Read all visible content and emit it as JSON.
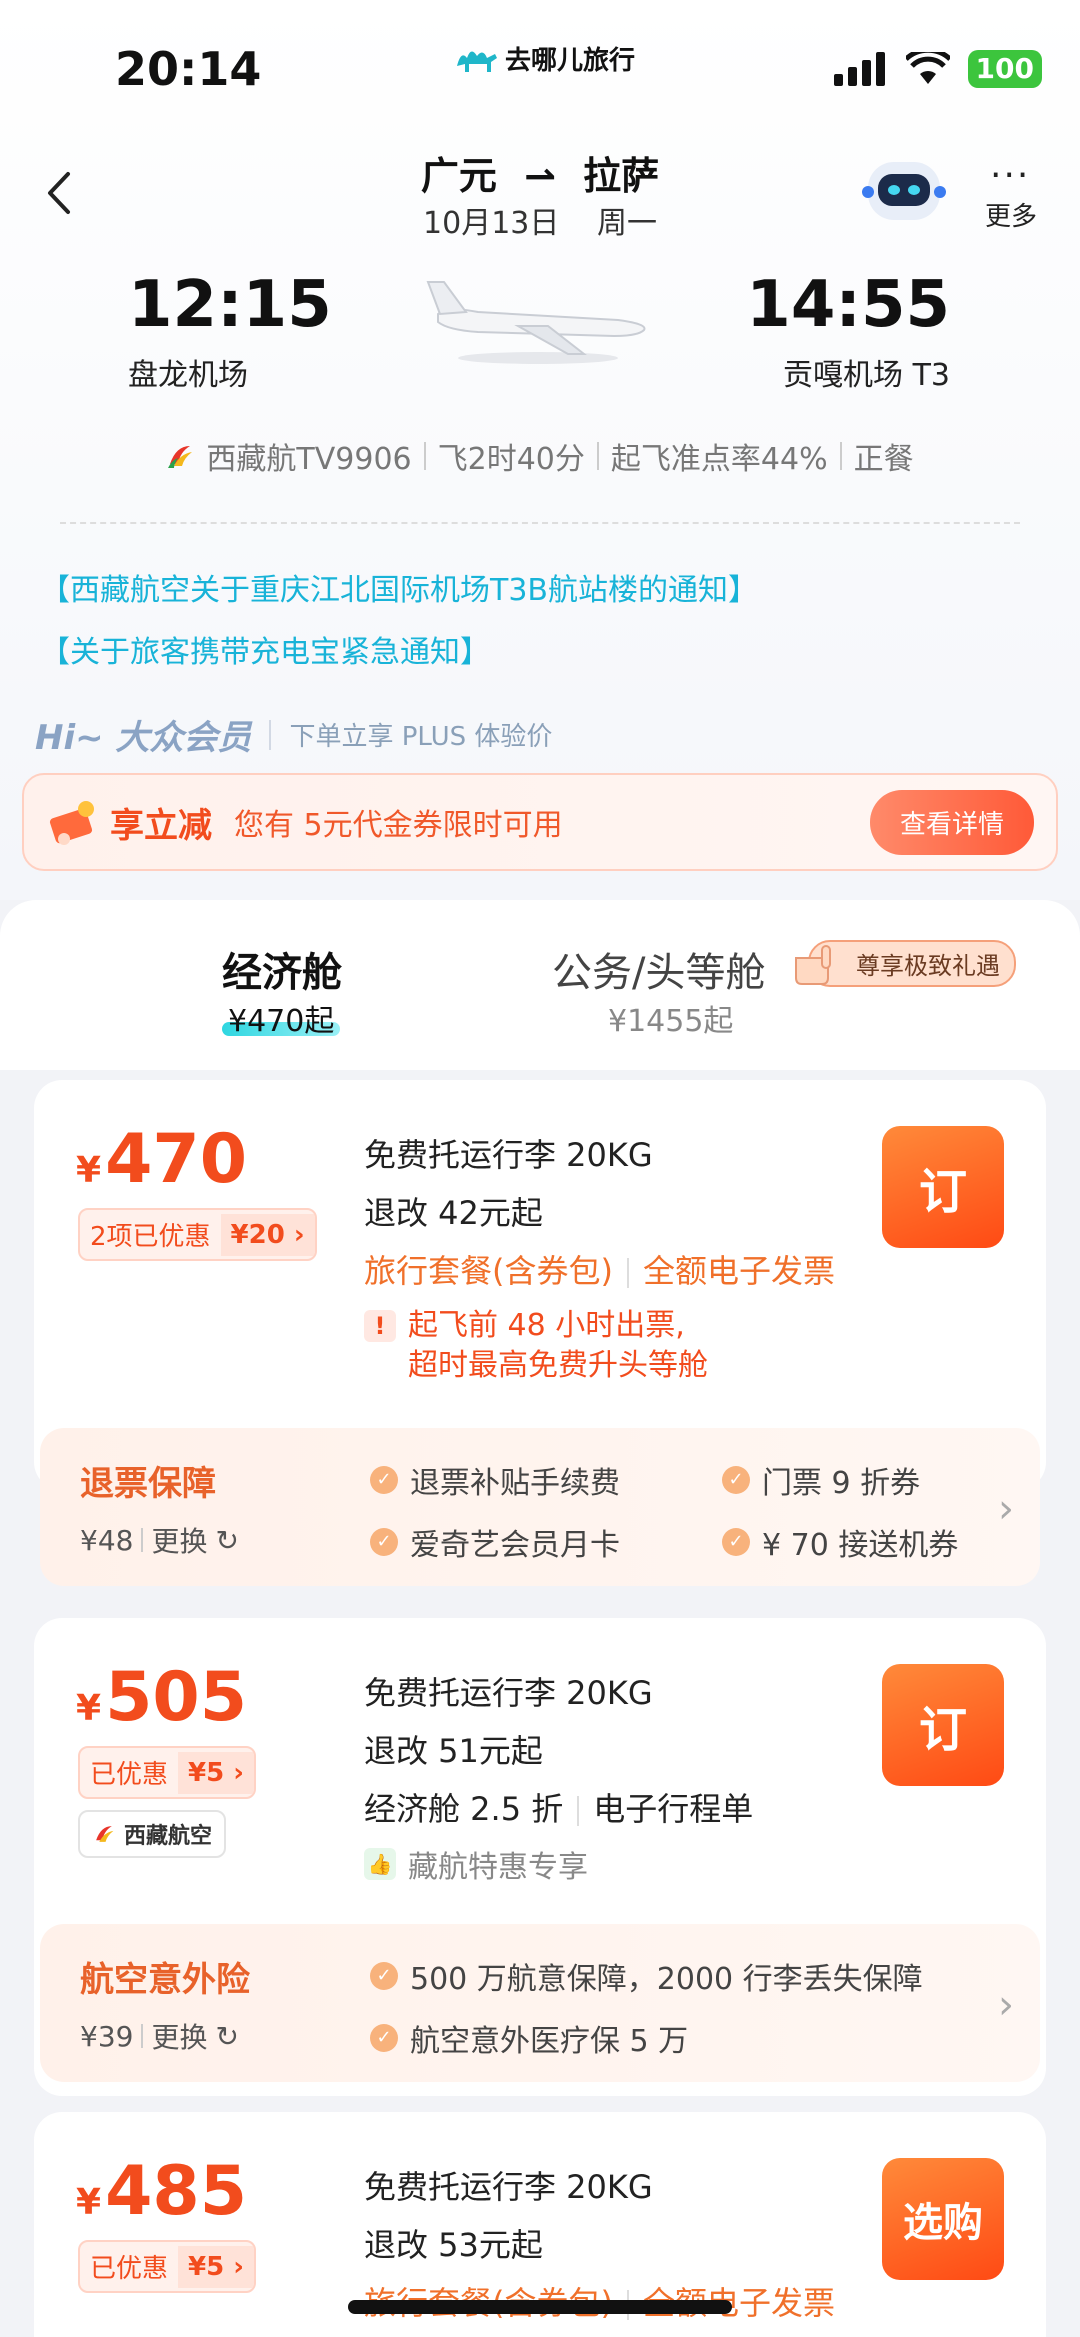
{
  "status_bar": {
    "time": "20:14",
    "app_name": "去哪儿旅行",
    "battery": "100"
  },
  "header": {
    "route_from": "广元",
    "route_to": "拉萨",
    "date": "10月13日",
    "weekday": "周一",
    "more_label": "更多"
  },
  "flight": {
    "dep_time": "12:15",
    "dep_airport": "盘龙机场",
    "arr_time": "14:55",
    "arr_airport": "贡嘎机场 T3",
    "airline_flight": "西藏航TV9906",
    "duration": "飞2时40分",
    "ontime": "起飞准点率44%",
    "meal": "正餐"
  },
  "notices": [
    "【西藏航空关于重庆江北国际机场T3B航站楼的通知】",
    "【关于旅客携带充电宝紧急通知】"
  ],
  "member": {
    "title": "Hi~ 大众会员",
    "subtitle": "下单立享 PLUS 体验价"
  },
  "promo": {
    "title": "享立减",
    "text": "您有 5元代金券限时可用",
    "button": "查看详情"
  },
  "tabs": {
    "economy": {
      "label": "经济舱",
      "price": "¥470起"
    },
    "business": {
      "label": "公务/头等舱",
      "price": "¥1455起",
      "badge": "尊享极致礼遇"
    }
  },
  "cards": [
    {
      "price_symbol": "¥",
      "price": "470",
      "discount_label": "2项已优惠",
      "discount_value": "¥20",
      "line1": "免费托运行李 20KG",
      "line2": "退改 42元起",
      "line3a": "旅行套餐(含券包)",
      "line3b": "全额电子发票",
      "warn_line1": "起飞前 48 小时出票,",
      "warn_line2": "超时最高免费升头等舱",
      "button": "订",
      "ins": {
        "title": "退票保障",
        "price": "¥48",
        "change": "更换",
        "items": [
          "退票补贴手续费",
          "门票 9 折券",
          "爱奇艺会员月卡",
          "¥ 70 接送机券"
        ]
      }
    },
    {
      "price_symbol": "¥",
      "price": "505",
      "discount_label": "已优惠",
      "discount_value": "¥5",
      "airline_tag": "西藏航空",
      "line1": "免费托运行李 20KG",
      "line2": "退改 51元起",
      "line3a": "经济舱 2.5 折",
      "line3b": "电子行程单",
      "green_tag": "藏航特惠专享",
      "button": "订",
      "ins": {
        "title": "航空意外险",
        "price": "¥39",
        "change": "更换",
        "items": [
          "500 万航意保障，2000 行李丢失保障",
          "航空意外医疗保 5 万"
        ]
      }
    },
    {
      "price_symbol": "¥",
      "price": "485",
      "discount_label": "已优惠",
      "discount_value": "¥5",
      "line1": "免费托运行李 20KG",
      "line2": "退改 53元起",
      "line3a": "旅行套餐(含券包)",
      "line3b": "全额电子发票",
      "button": "选购"
    }
  ]
}
